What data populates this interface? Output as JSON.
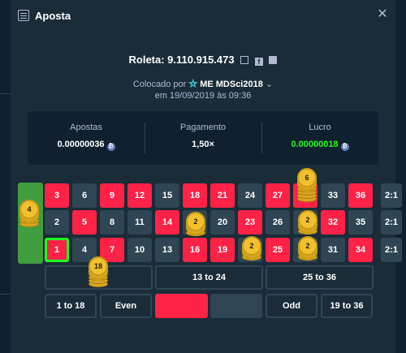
{
  "header": {
    "title": "Aposta",
    "close": "✕"
  },
  "bet": {
    "roleta_label": "Roleta: 9.110.915.473",
    "placed_prefix": "Colocado por",
    "username": "ME MDSci2018",
    "dropdown": "⌄",
    "date_line": "em 19/09/2019 às 09:36"
  },
  "stats": {
    "bets_label": "Apostas",
    "bets_value": "0.00000036",
    "payout_label": "Pagamento",
    "payout_value": "1,50×",
    "profit_label": "Lucro",
    "profit_value": "0.00000018",
    "coin": "₿"
  },
  "board": {
    "zero": "0",
    "rows": [
      [
        {
          "n": "3",
          "c": "red"
        },
        {
          "n": "6",
          "c": "black"
        },
        {
          "n": "9",
          "c": "red"
        },
        {
          "n": "12",
          "c": "red"
        },
        {
          "n": "15",
          "c": "black"
        },
        {
          "n": "18",
          "c": "red"
        },
        {
          "n": "21",
          "c": "red"
        },
        {
          "n": "24",
          "c": "black"
        },
        {
          "n": "27",
          "c": "red"
        },
        {
          "n": "30",
          "c": "red"
        },
        {
          "n": "33",
          "c": "black"
        },
        {
          "n": "36",
          "c": "red"
        }
      ],
      [
        {
          "n": "2",
          "c": "black"
        },
        {
          "n": "5",
          "c": "red"
        },
        {
          "n": "8",
          "c": "black"
        },
        {
          "n": "11",
          "c": "black"
        },
        {
          "n": "14",
          "c": "red"
        },
        {
          "n": "17",
          "c": "black"
        },
        {
          "n": "20",
          "c": "black"
        },
        {
          "n": "23",
          "c": "red"
        },
        {
          "n": "26",
          "c": "black"
        },
        {
          "n": "29",
          "c": "black"
        },
        {
          "n": "32",
          "c": "red"
        },
        {
          "n": "35",
          "c": "black"
        }
      ],
      [
        {
          "n": "1",
          "c": "red"
        },
        {
          "n": "4",
          "c": "black"
        },
        {
          "n": "7",
          "c": "red"
        },
        {
          "n": "10",
          "c": "black"
        },
        {
          "n": "13",
          "c": "black"
        },
        {
          "n": "16",
          "c": "red"
        },
        {
          "n": "19",
          "c": "red"
        },
        {
          "n": "22",
          "c": "black"
        },
        {
          "n": "25",
          "c": "red"
        },
        {
          "n": "28",
          "c": "black"
        },
        {
          "n": "31",
          "c": "black"
        },
        {
          "n": "34",
          "c": "red"
        }
      ]
    ],
    "column_bets": [
      "2:1",
      "2:1",
      "2:1"
    ],
    "dozens": [
      "1 to 12",
      "13 to 24",
      "25 to 36"
    ],
    "outside": [
      "1 to 18",
      "Even",
      "",
      "",
      "Odd",
      "19 to 36"
    ],
    "chips": {
      "zero": "4",
      "dozen1": "18",
      "sq_17": "2",
      "sq_22": "2",
      "row1_33": "6",
      "row2_32": "2",
      "row3_31": "2"
    },
    "colors": {
      "red": "#fe2247",
      "black": "#2f4553",
      "green": "#419e3f",
      "chip": "#f2c02f"
    }
  }
}
